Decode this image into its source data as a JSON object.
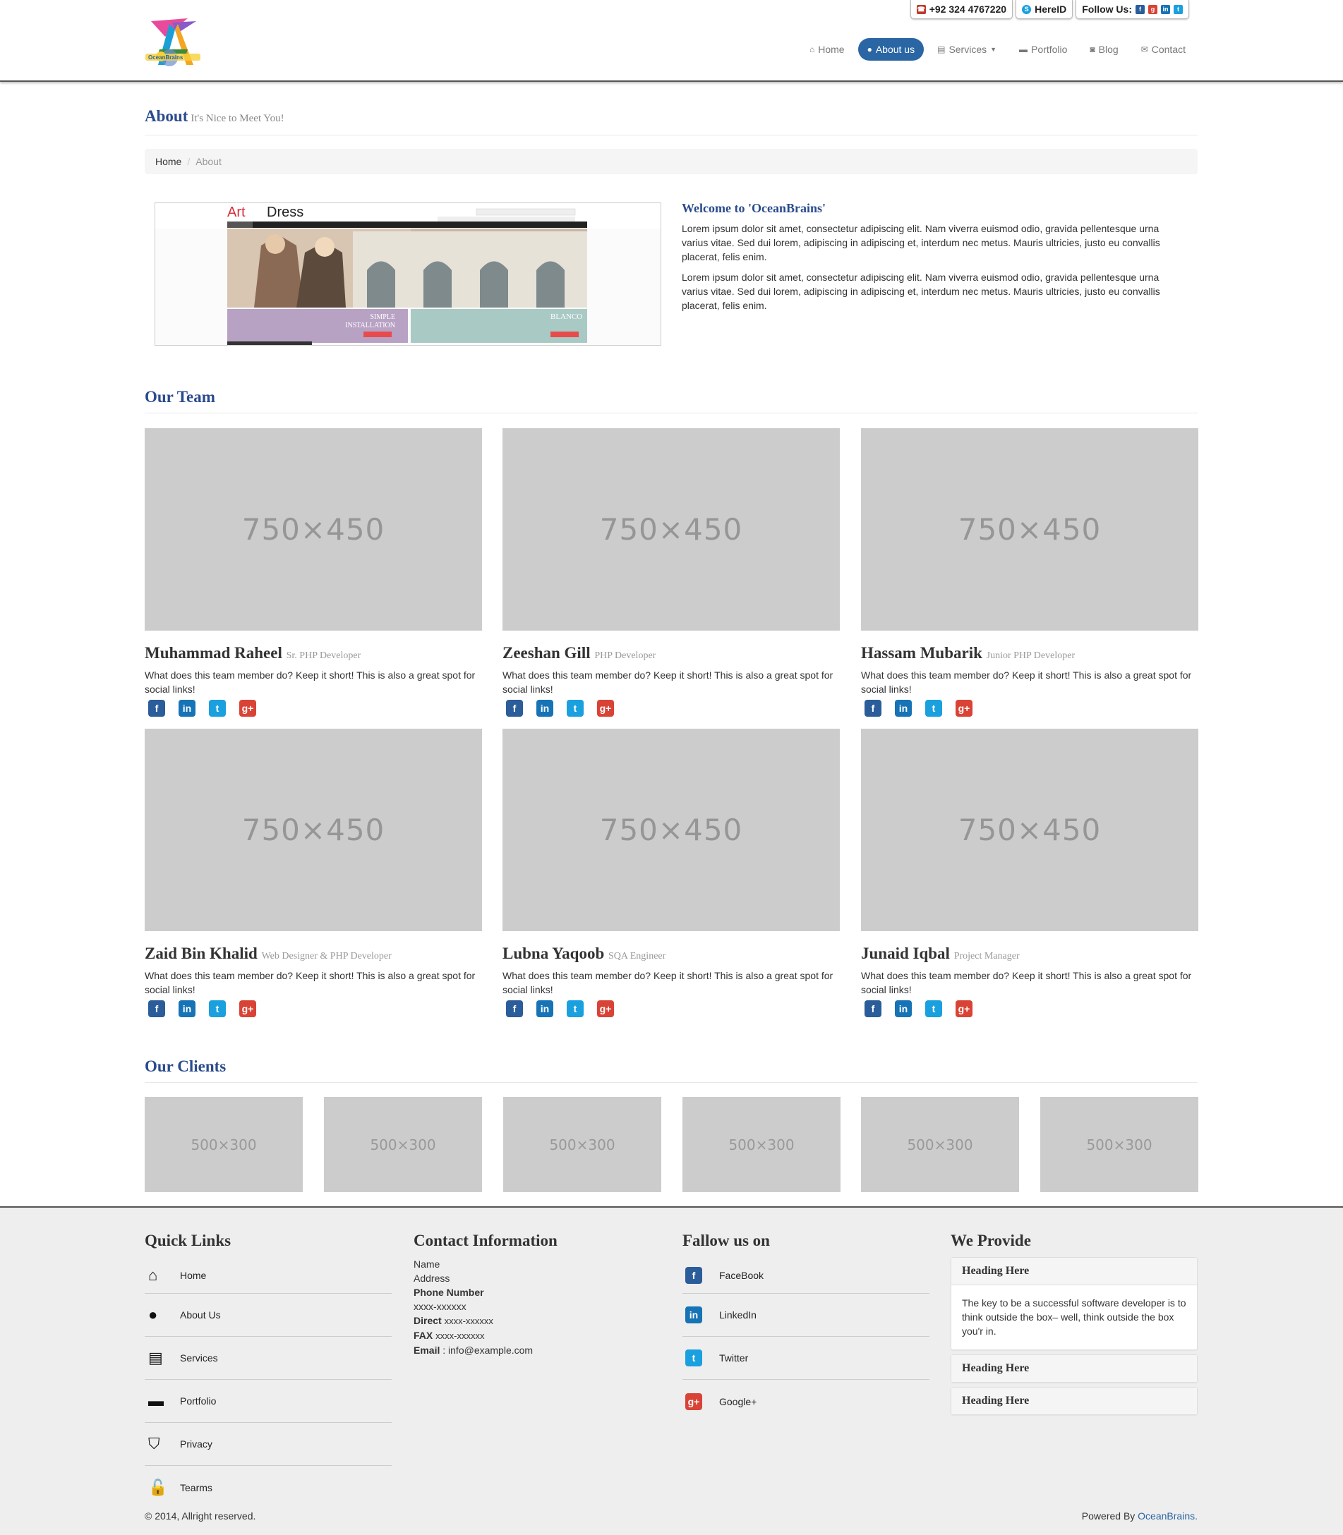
{
  "topbar": {
    "phone": "+92 324 4767220",
    "skype": "HereID",
    "follow": "Follow Us:"
  },
  "nav": [
    {
      "label": "Home",
      "icon": "home-icon",
      "active": false
    },
    {
      "label": "About us",
      "icon": "user-icon",
      "active": true
    },
    {
      "label": "Services",
      "icon": "book-icon",
      "active": false
    },
    {
      "label": "Portfolio",
      "icon": "folder-icon",
      "active": false
    },
    {
      "label": "Blog",
      "icon": "rss-icon",
      "active": false
    },
    {
      "label": "Contact",
      "icon": "envelope-icon",
      "active": false
    }
  ],
  "page": {
    "title": "About",
    "subtitle": "It's Nice to Meet You!"
  },
  "breadcrumb": {
    "home": "Home",
    "current": "About"
  },
  "showcase": {
    "brand_art": "Art",
    "brand_dress": "Dress",
    "tag_simple": "SIMPLE",
    "tag_installation": "INSTALLATION",
    "tag_blanco": "BLANCO"
  },
  "welcome": {
    "heading": "Welcome to 'OceanBrains'",
    "p1": "Lorem ipsum dolor sit amet, consectetur adipiscing elit. Nam viverra euismod odio, gravida pellentesque urna varius vitae. Sed dui lorem, adipiscing in adipiscing et, interdum nec metus. Mauris ultricies, justo eu convallis placerat, felis enim.",
    "p2": "Lorem ipsum dolor sit amet, consectetur adipiscing elit. Nam viverra euismod odio, gravida pellentesque urna varius vitae. Sed dui lorem, adipiscing in adipiscing et, interdum nec metus. Mauris ultricies, justo eu convallis placerat, felis enim."
  },
  "team": {
    "title": "Our Team",
    "placeholder": "750×450",
    "description": "What does this team member do? Keep it short! This is also a great spot for social links!",
    "members": [
      {
        "name": "Muhammad Raheel",
        "role": "Sr. PHP Developer"
      },
      {
        "name": "Zeeshan Gill",
        "role": "PHP Developer"
      },
      {
        "name": "Hassam Mubarik",
        "role": "Junior PHP Developer"
      },
      {
        "name": "Zaid Bin Khalid",
        "role": "Web Designer & PHP Developer"
      },
      {
        "name": "Lubna Yaqoob",
        "role": "SQA Engineer"
      },
      {
        "name": "Junaid Iqbal",
        "role": "Project Manager"
      }
    ],
    "social": [
      "facebook-icon",
      "linkedin-icon",
      "twitter-icon",
      "google-plus-icon"
    ]
  },
  "clients": {
    "title": "Our Clients",
    "placeholder": "500×300"
  },
  "footer": {
    "quick_links": {
      "title": "Quick Links",
      "items": [
        {
          "label": "Home",
          "icon": "home-icon"
        },
        {
          "label": "About Us",
          "icon": "user-icon"
        },
        {
          "label": "Services",
          "icon": "book-icon"
        },
        {
          "label": "Portfolio",
          "icon": "folder-icon"
        },
        {
          "label": "Privacy",
          "icon": "shield-icon"
        },
        {
          "label": "Tearms",
          "icon": "unlock-icon"
        }
      ]
    },
    "contact": {
      "title": "Contact Information",
      "name": "Name",
      "address": "Address",
      "phone_label": "Phone Number",
      "phone_value": "xxxx-xxxxxx",
      "direct_label": "Direct",
      "direct_value": "xxxx-xxxxxx",
      "fax_label": "FAX",
      "fax_value": "xxxx-xxxxxx",
      "email_label": "Email",
      "email_value": " : info@example.com"
    },
    "follow": {
      "title": "Fallow us on",
      "items": [
        {
          "label": "FaceBook",
          "icon": "facebook-icon"
        },
        {
          "label": "LinkedIn",
          "icon": "linkedin-icon"
        },
        {
          "label": "Twitter",
          "icon": "twitter-icon"
        },
        {
          "label": "Google+",
          "icon": "google-plus-icon"
        }
      ]
    },
    "provide": {
      "title": "We Provide",
      "panels": [
        {
          "heading": "Heading Here",
          "body": "The key to be a successful software developer is to think outside the box– well, think outside the box you'r in."
        },
        {
          "heading": "Heading Here"
        },
        {
          "heading": "Heading Here"
        }
      ]
    },
    "copyright": "© 2014, Allright reserved.",
    "powered_prefix": "Powered By ",
    "powered_link": "OceanBrains."
  },
  "colors": {
    "accent": "#2a66a4",
    "heading": "#2a4b8d",
    "facebook": "#2a5d9a",
    "linkedin": "#1673b6",
    "twitter": "#1aa0df",
    "google_plus": "#d94335"
  }
}
